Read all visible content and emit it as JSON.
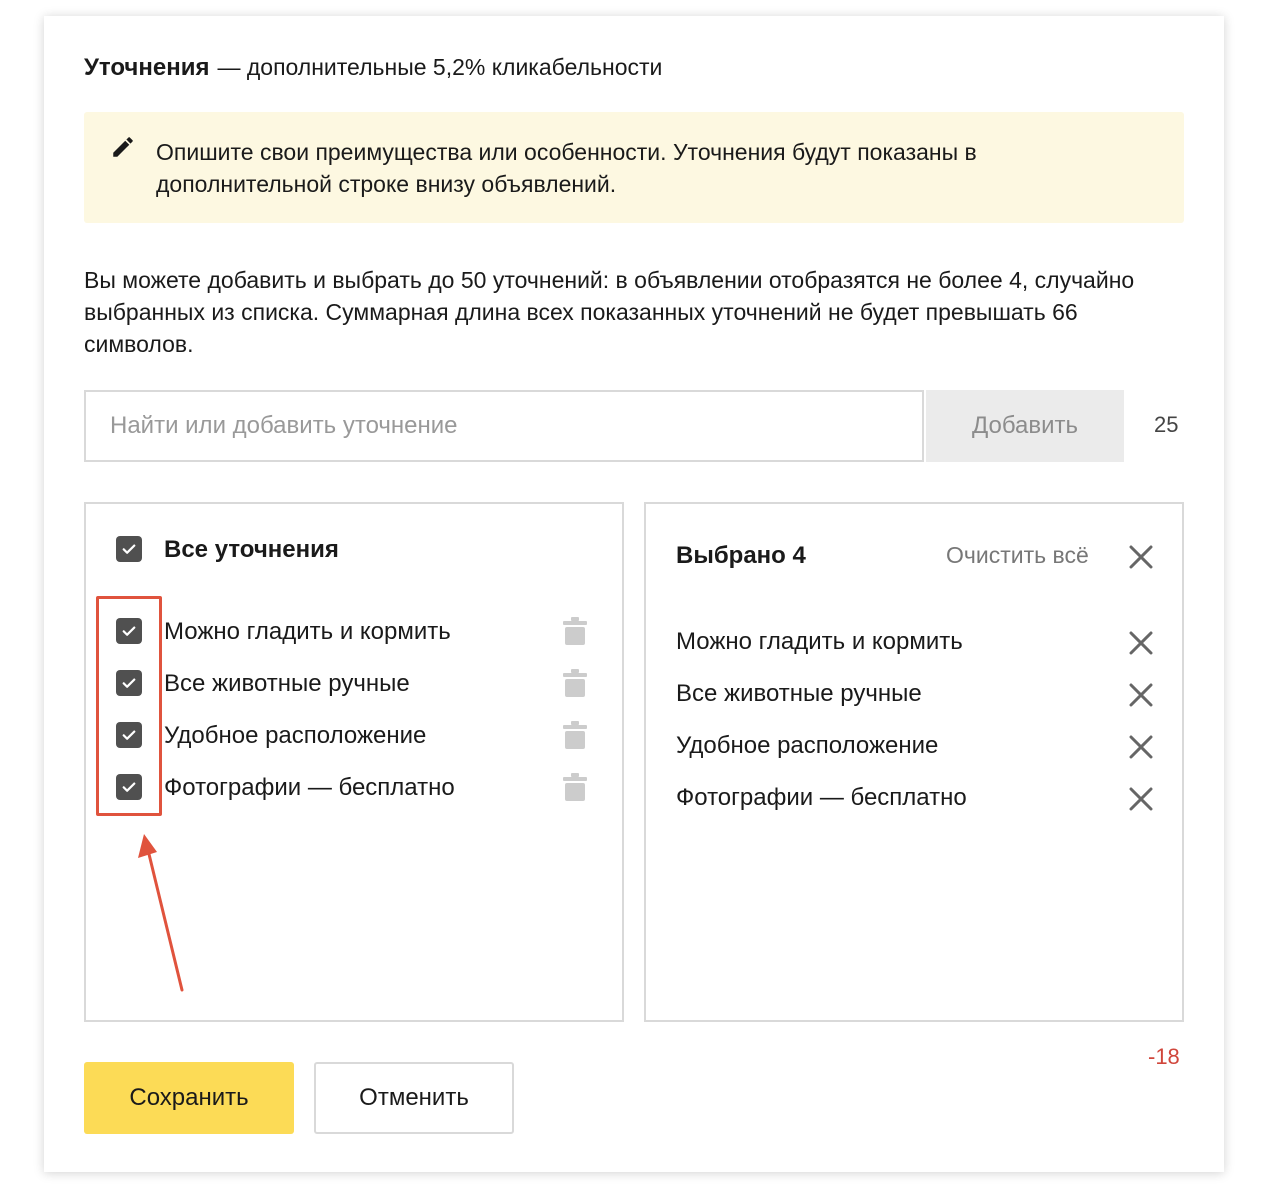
{
  "header": {
    "title": "Уточнения",
    "subtitle": "— дополнительные 5,2% кликабельности"
  },
  "hint": {
    "text": "Опишите свои преимущества или особенности. Уточнения будут показаны в дополнительной строке внизу объявлений.",
    "icon": "pencil-icon"
  },
  "description": "Вы можете добавить и выбрать до 50 уточнений: в объявлении отобразятся не более 4, случайно выбранных из списка. Суммарная длина всех показанных уточнений не будет превышать 66 символов.",
  "search": {
    "placeholder": "Найти или добавить уточнение",
    "value": "",
    "add_label": "Добавить",
    "counter": "25"
  },
  "all_list": {
    "select_all_label": "Все уточнения",
    "items": [
      {
        "label": "Можно гладить и кормить",
        "checked": true
      },
      {
        "label": "Все животные ручные",
        "checked": true
      },
      {
        "label": "Удобное расположение",
        "checked": true
      },
      {
        "label": "Фотографии — бесплатно",
        "checked": true
      }
    ]
  },
  "selected_list": {
    "title": "Выбрано 4",
    "clear_label": "Очистить всё",
    "items": [
      {
        "label": "Можно гладить и кормить"
      },
      {
        "label": "Все животные ручные"
      },
      {
        "label": "Удобное расположение"
      },
      {
        "label": "Фотографии — бесплатно"
      }
    ]
  },
  "remaining_chars": "-18",
  "footer": {
    "save_label": "Сохранить",
    "cancel_label": "Отменить"
  },
  "colors": {
    "accent_yellow": "#fcdb56",
    "hint_bg": "#fdf8e1",
    "annotation_red": "#e0533d",
    "warning_red": "#d0463b"
  }
}
